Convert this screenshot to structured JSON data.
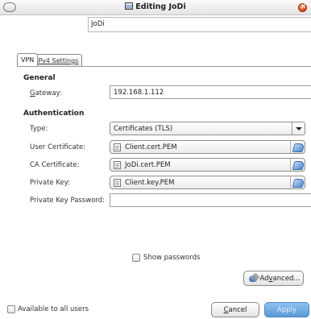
{
  "window": {
    "title": "Editing JoDi",
    "icons": [
      "window-menu-icon",
      "network-icon",
      "close-icon"
    ]
  },
  "connection": {
    "name_value": "JoDi"
  },
  "tabs": [
    {
      "label": "VPN",
      "active": true
    },
    {
      "label": "IPv4 Settings",
      "active": false
    }
  ],
  "general": {
    "heading": "General",
    "gateway_label_mnemonic": "G",
    "gateway_label_rest": "ateway:",
    "gateway_value": "192.168.1.112"
  },
  "authentication": {
    "heading": "Authentication",
    "type_label": "Type:",
    "type_value": "Certificates (TLS)",
    "user_cert_label": "User Certificate:",
    "user_cert_value": "Client.cert.PEM",
    "ca_cert_label": "CA Certificate:",
    "ca_cert_value": "JoDi.cert.PEM",
    "private_key_label": "Private Key:",
    "private_key_value": "Client.key.PEM",
    "private_key_password_label": "Private Key Password:",
    "private_key_password_value": ""
  },
  "show_passwords": {
    "label": "Show passwords",
    "checked": false
  },
  "advanced_button": {
    "label_before": "Ad",
    "mnemonic": "v",
    "label_after": "anced..."
  },
  "footer": {
    "available_to_all_users": {
      "label": "Available to all users",
      "checked": false
    },
    "cancel": {
      "mnemonic": "C",
      "rest": "ancel"
    },
    "apply": {
      "label": "Apply",
      "enabled": false
    }
  },
  "colors": {
    "apply_button": "#6aa6e0",
    "close_button": "#e0461a"
  }
}
